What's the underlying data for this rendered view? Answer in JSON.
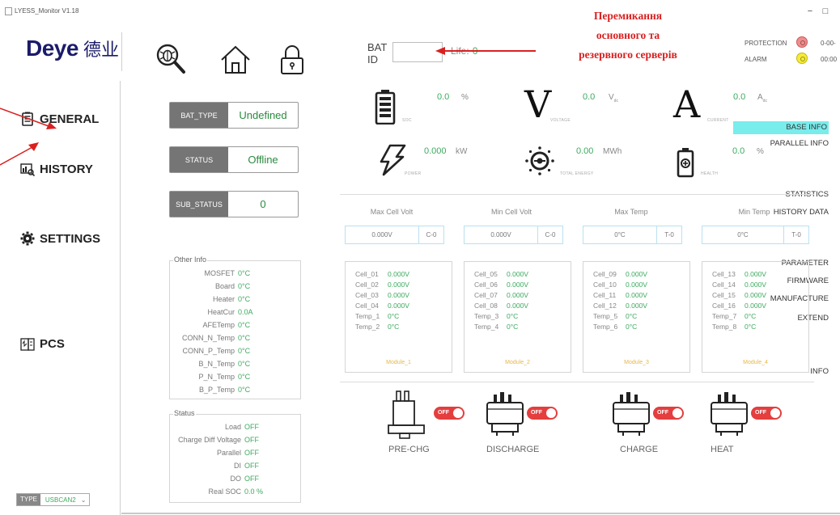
{
  "window": {
    "title": "LYESS_Monitor V1.18",
    "minimize": "−",
    "maximize": "□",
    "close": "×"
  },
  "header": {
    "logo_word": "Deye",
    "logo_cn": "德业",
    "icons": [
      "search-bug-icon",
      "home-icon",
      "lock-icon"
    ],
    "bat_id_label": "BAT ID",
    "bat_id_value": "",
    "life_label": "Life:",
    "life_value": "0",
    "annotation_lines": [
      "Перемикання",
      "основного та",
      "резервного серверів"
    ],
    "protection_label": "PROTECTION",
    "alarm_label": "ALARM",
    "time1": "0-00-",
    "time2": "00:00",
    "colors": {
      "protection": "#f18c8c",
      "alarm": "#f6ec39",
      "annotation": "#d92020"
    }
  },
  "sidebar": {
    "general": "GENERAL",
    "base_info": "BASE INFO",
    "parallel_info": "PARALLEL INFO",
    "history": "HISTORY",
    "statistics": "STATISTICS",
    "history_data": "HISTORY DATA",
    "settings": "SETTINGS",
    "parameter": "PARAMETER",
    "firmware": "FIRMWARE",
    "manufacture": "MANUFACTURE",
    "extend": "EXTEND",
    "pcs": "PCS",
    "info": "INFO",
    "type_label": "TYPE",
    "type_value": "USBCAN2",
    "type_arrow": "⌄",
    "active_color": "#79ecec"
  },
  "status_boxes": [
    {
      "key": "BAT_TYPE",
      "value": "Undefined"
    },
    {
      "key": "STATUS",
      "value": "Offline"
    },
    {
      "key": "SUB_STATUS",
      "value": "0"
    }
  ],
  "other_info": {
    "title": "Other Info",
    "rows": [
      {
        "label": "MOSFET",
        "value": "0°C"
      },
      {
        "label": "Board",
        "value": "0°C"
      },
      {
        "label": "Heater",
        "value": "0°C"
      },
      {
        "label": "HeatCur",
        "value": "0.0A"
      },
      {
        "label": "AFETemp",
        "value": "0°C"
      },
      {
        "label": "CONN_N_Temp",
        "value": "0°C"
      },
      {
        "label": "CONN_P_Temp",
        "value": "0°C"
      },
      {
        "label": "B_N_Temp",
        "value": "0°C"
      },
      {
        "label": "P_N_Temp",
        "value": "0°C"
      },
      {
        "label": "B_P_Temp",
        "value": "0°C"
      }
    ]
  },
  "status_panel": {
    "title": "Status",
    "rows": [
      {
        "label": "Load",
        "value": "OFF"
      },
      {
        "label": "Charge Diff Voltage",
        "value": "OFF"
      },
      {
        "label": "Parallel",
        "value": "OFF"
      },
      {
        "label": "DI",
        "value": "OFF"
      },
      {
        "label": "DO",
        "value": "OFF"
      },
      {
        "label": "Real SOC",
        "value": "0.0 %"
      }
    ]
  },
  "readings": {
    "soc": {
      "value": "0.0",
      "unit": "%",
      "caption": "SOC"
    },
    "voltage": {
      "value": "0.0",
      "unit": "V",
      "unit_sub": "dc",
      "caption": "VOLTAGE"
    },
    "current": {
      "value": "0.0",
      "unit": "A",
      "unit_sub": "dc",
      "caption": "CURRENT"
    },
    "power": {
      "value": "0.000",
      "unit": "kW",
      "caption": "POWER"
    },
    "energy": {
      "value": "0.00",
      "unit": "MWh",
      "caption": "TOTAL ENERGY"
    },
    "health": {
      "value": "0.0",
      "unit": "%",
      "caption": "HEALTH"
    }
  },
  "extremes": [
    {
      "label": "Max Cell Volt",
      "value": "0.000V",
      "tag": "C-0"
    },
    {
      "label": "Min Cell Volt",
      "value": "0.000V",
      "tag": "C-0"
    },
    {
      "label": "Max Temp",
      "value": "0°C",
      "tag": "T-0"
    },
    {
      "label": "Min Temp",
      "value": "0°C",
      "tag": "T-0"
    }
  ],
  "modules": [
    {
      "name": "Module_1",
      "rows": [
        {
          "l": "Cell_01",
          "v": "0.000V"
        },
        {
          "l": "Cell_02",
          "v": "0.000V"
        },
        {
          "l": "Cell_03",
          "v": "0.000V"
        },
        {
          "l": "Cell_04",
          "v": "0.000V"
        },
        {
          "l": "Temp_1",
          "v": "0°C"
        },
        {
          "l": "Temp_2",
          "v": "0°C"
        }
      ]
    },
    {
      "name": "Module_2",
      "rows": [
        {
          "l": "Cell_05",
          "v": "0.000V"
        },
        {
          "l": "Cell_06",
          "v": "0.000V"
        },
        {
          "l": "Cell_07",
          "v": "0.000V"
        },
        {
          "l": "Cell_08",
          "v": "0.000V"
        },
        {
          "l": "Temp_3",
          "v": "0°C"
        },
        {
          "l": "Temp_4",
          "v": "0°C"
        }
      ]
    },
    {
      "name": "Module_3",
      "rows": [
        {
          "l": "Cell_09",
          "v": "0.000V"
        },
        {
          "l": "Cell_10",
          "v": "0.000V"
        },
        {
          "l": "Cell_11",
          "v": "0.000V"
        },
        {
          "l": "Cell_12",
          "v": "0.000V"
        },
        {
          "l": "Temp_5",
          "v": "0°C"
        },
        {
          "l": "Temp_6",
          "v": "0°C"
        }
      ]
    },
    {
      "name": "Module_4",
      "rows": [
        {
          "l": "Cell_13",
          "v": "0.000V"
        },
        {
          "l": "Cell_14",
          "v": "0.000V"
        },
        {
          "l": "Cell_15",
          "v": "0.000V"
        },
        {
          "l": "Cell_16",
          "v": "0.000V"
        },
        {
          "l": "Temp_7",
          "v": "0°C"
        },
        {
          "l": "Temp_8",
          "v": "0°C"
        }
      ]
    }
  ],
  "relays": [
    {
      "label": "PRE-CHG",
      "state": "OFF"
    },
    {
      "label": "DISCHARGE",
      "state": "OFF"
    },
    {
      "label": "CHARGE",
      "state": "OFF"
    },
    {
      "label": "HEAT",
      "state": "OFF"
    }
  ]
}
